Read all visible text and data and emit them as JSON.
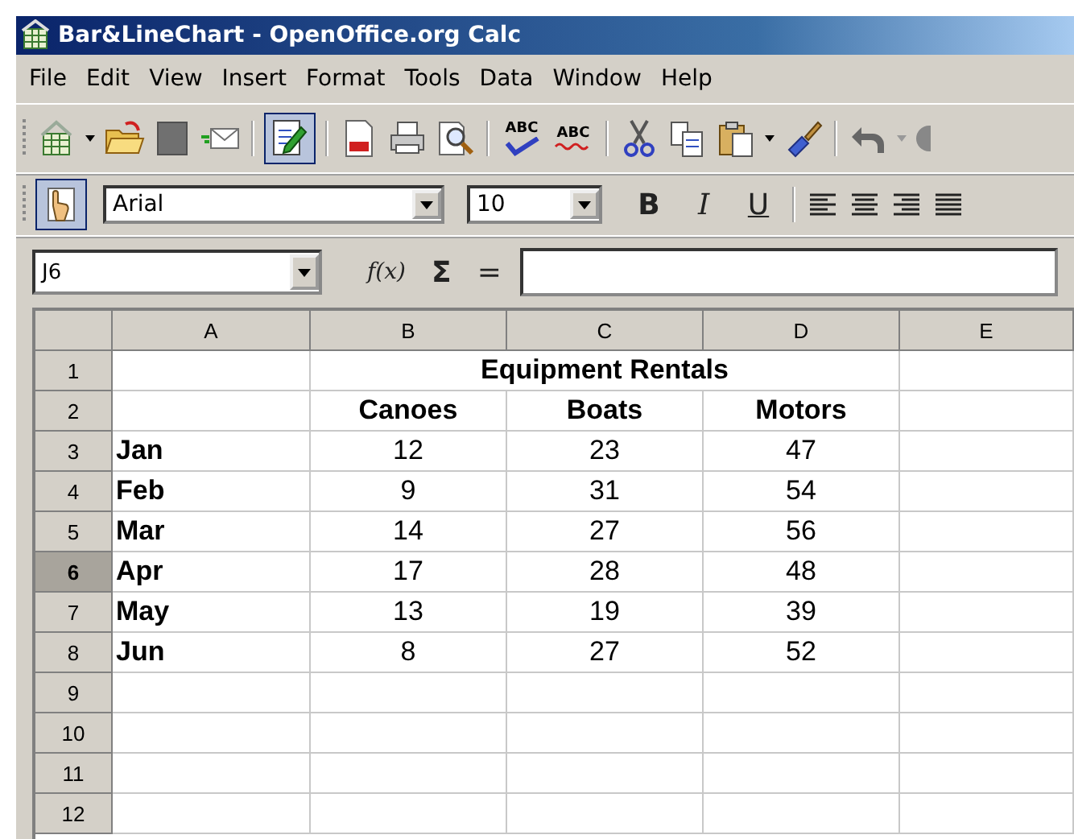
{
  "window": {
    "title": "Bar&LineChart - OpenOffice.org Calc"
  },
  "menu": [
    {
      "label": "File"
    },
    {
      "label": "Edit"
    },
    {
      "label": "View"
    },
    {
      "label": "Insert"
    },
    {
      "label": "Format"
    },
    {
      "label": "Tools"
    },
    {
      "label": "Data"
    },
    {
      "label": "Window"
    },
    {
      "label": "Help"
    }
  ],
  "standard_toolbar": {
    "edit_file_on": true,
    "spellcheck": "ABC",
    "autospellcheck": "ABC"
  },
  "formatting_toolbar": {
    "draw_functions_on": true,
    "font": "Arial",
    "size": "10",
    "bold": "B",
    "italic": "I",
    "underline": "U"
  },
  "formula_bar": {
    "name_box": "J6",
    "function_wizard": "f(x)",
    "sum": "Σ",
    "equals": "="
  },
  "sheet": {
    "columns": [
      {
        "label": "A",
        "selected": false
      },
      {
        "label": "B",
        "selected": false
      },
      {
        "label": "C",
        "selected": false
      },
      {
        "label": "D",
        "selected": false
      },
      {
        "label": "E",
        "selected": false
      }
    ],
    "rows": [
      {
        "label": "1",
        "selected": false,
        "kind": "title",
        "cells": {
          "B": "Equipment Rentals"
        }
      },
      {
        "label": "2",
        "selected": false,
        "kind": "header",
        "cells": {
          "B": "Canoes",
          "C": "Boats",
          "D": "Motors"
        }
      },
      {
        "label": "3",
        "selected": false,
        "kind": "data",
        "cells": {
          "A": "Jan",
          "B": "12",
          "C": "23",
          "D": "47"
        }
      },
      {
        "label": "4",
        "selected": false,
        "kind": "data",
        "cells": {
          "A": "Feb",
          "B": "9",
          "C": "31",
          "D": "54"
        }
      },
      {
        "label": "5",
        "selected": false,
        "kind": "data",
        "cells": {
          "A": "Mar",
          "B": "14",
          "C": "27",
          "D": "56"
        }
      },
      {
        "label": "6",
        "selected": true,
        "kind": "data",
        "cells": {
          "A": "Apr",
          "B": "17",
          "C": "28",
          "D": "48"
        }
      },
      {
        "label": "7",
        "selected": false,
        "kind": "data",
        "cells": {
          "A": "May",
          "B": "13",
          "C": "19",
          "D": "39"
        }
      },
      {
        "label": "8",
        "selected": false,
        "kind": "data",
        "cells": {
          "A": "Jun",
          "B": "8",
          "C": "27",
          "D": "52"
        }
      },
      {
        "label": "9",
        "selected": false,
        "kind": "data"
      },
      {
        "label": "10",
        "selected": false,
        "kind": "data"
      },
      {
        "label": "11",
        "selected": false,
        "kind": "data"
      },
      {
        "label": "12",
        "selected": false,
        "kind": "data"
      }
    ]
  }
}
